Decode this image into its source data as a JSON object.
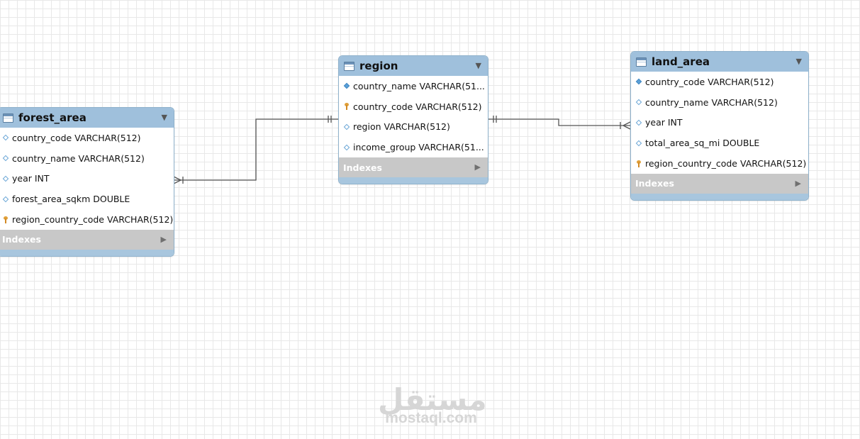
{
  "tables": {
    "forest_area": {
      "name": "forest_area",
      "columns": [
        "country_code VARCHAR(512)",
        "country_name VARCHAR(512)",
        "year INT",
        "forest_area_sqkm DOUBLE",
        "region_country_code VARCHAR(512)"
      ],
      "indexes_label": "Indexes"
    },
    "region": {
      "name": "region",
      "columns": [
        "country_name VARCHAR(51...",
        "country_code VARCHAR(512)",
        "region VARCHAR(512)",
        "income_group VARCHAR(51..."
      ],
      "indexes_label": "Indexes"
    },
    "land_area": {
      "name": "land_area",
      "columns": [
        "country_code VARCHAR(512)",
        "country_name VARCHAR(512)",
        "year INT",
        "total_area_sq_mi DOUBLE",
        "region_country_code VARCHAR(512)"
      ],
      "indexes_label": "Indexes"
    }
  },
  "watermark": {
    "arabic": "مستقل",
    "latin": "mostaql.com"
  },
  "colors": {
    "header": "#9fc0dc",
    "indexes_bar": "#c8c8c8",
    "key_icon": "#e0a03a",
    "column_icon": "#6aa6d6",
    "connector": "#555555"
  }
}
